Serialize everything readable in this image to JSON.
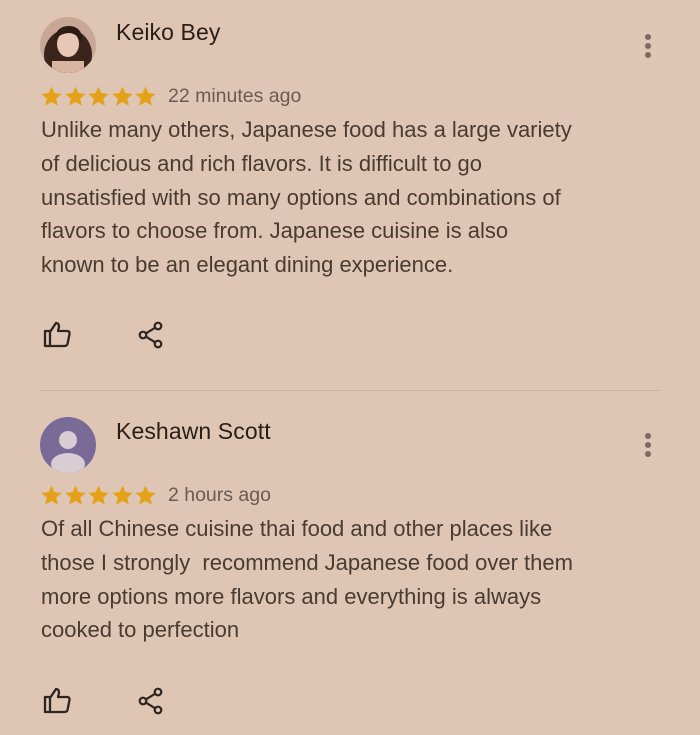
{
  "reviews": [
    {
      "name": "Keiko Bey",
      "rating": 5,
      "time": "22 minutes ago",
      "text": "Unlike many others, Japanese food has a large variety of delicious and rich flavors. It is difficult to go unsatisfied with so many options and combinations of flavors to choose from. Japanese cuisine is also known to be an elegant dining experience.",
      "lines": [
        "Unlike many others, Japanese food has a large variety",
        "of delicious and rich flavors. It is difficult to go",
        "unsatisfied with so many options and combinations of",
        "flavors to choose from. Japanese cuisine is also",
        "known to be an elegant dining experience."
      ],
      "avatar": "photo-avatar"
    },
    {
      "name": "Keshawn Scott",
      "rating": 5,
      "time": "2 hours ago",
      "lines": [
        "Of all Chinese cuisine thai food and other places like",
        "those I strongly  recommend Japanese food over them",
        "more options more flavors and everything is always",
        "cooked to perfection"
      ],
      "avatar": "default-person-avatar"
    }
  ],
  "icons": {
    "more": "more-vertical-icon",
    "like": "thumbs-up-icon",
    "share": "share-icon",
    "star": "star-icon"
  },
  "colors": {
    "background": "#dfc6b4",
    "star": "#e3a21a",
    "name": "#2a1d16",
    "text": "#4a3a30",
    "meta": "#6b5a50",
    "icon": "#2f2520",
    "divider": "#c8b3a3",
    "avatar_default_bg": "#7a6a98"
  }
}
